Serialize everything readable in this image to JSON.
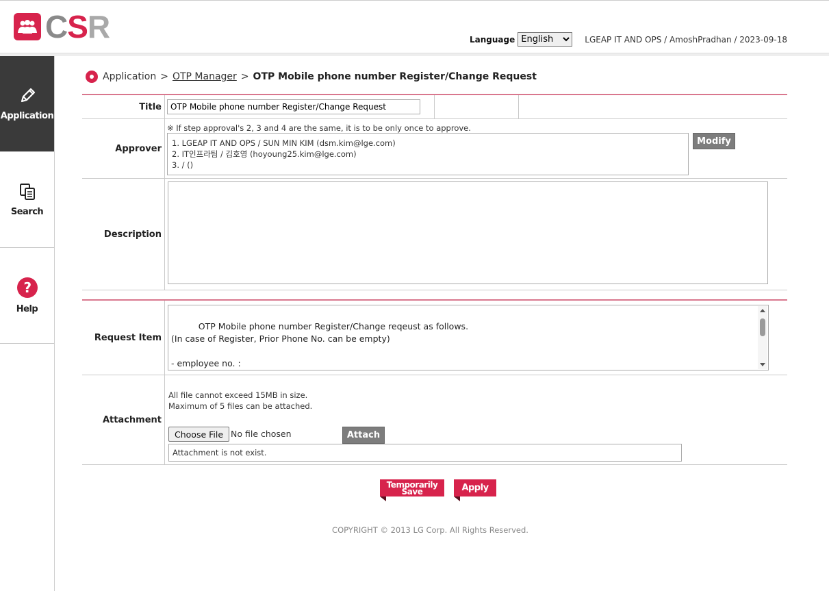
{
  "header": {
    "logo_text": "CSR",
    "language_label": "Language",
    "language_selected": "English",
    "user_info": "LGEAP IT AND OPS / AmoshPradhan / 2023-09-18"
  },
  "sidebar": {
    "items": [
      {
        "label": "Application",
        "icon": "pencil-icon",
        "active": true
      },
      {
        "label": "Search",
        "icon": "documents-icon",
        "active": false
      },
      {
        "label": "Help",
        "icon": "question-icon",
        "active": false
      }
    ]
  },
  "breadcrumb": {
    "root": "Application",
    "sep": ">",
    "link": "OTP Manager",
    "current": "OTP Mobile phone number Register/Change Request"
  },
  "form": {
    "title_label": "Title",
    "title_value": "OTP Mobile phone number Register/Change Request",
    "approver_label": "Approver",
    "approver_note": "※ If step approval's 2, 3 and 4 are the same, it is to be only once to approve.",
    "approvers": [
      "1. LGEAP IT AND OPS / SUN MIN KIM (dsm.kim@lge.com)",
      "2. IT인프라팀 / 김호영 (hoyoung25.kim@lge.com)",
      "3. / ()"
    ],
    "modify_label": "Modify",
    "description_label": "Description",
    "request_label": "Request Item",
    "request_text": "OTP Mobile phone number Register/Change reqeust as follows.\n(In case of Register, Prior Phone No. can be empty)\n\n- employee no. :\n- SSO/EP ID :",
    "attachment_label": "Attachment",
    "attachment_note_1": "All file cannot exceed 15MB in size.",
    "attachment_note_2": "Maximum of 5 files can be attached.",
    "choose_file_label": "Choose File",
    "no_file_text": "No file chosen",
    "attach_label": "Attach",
    "attachment_status": "Attachment is not exist."
  },
  "actions": {
    "temp_save_line1": "Temporarily",
    "temp_save_line2": "Save",
    "apply_label": "Apply"
  },
  "footer": {
    "copyright": "COPYRIGHT © 2013 LG Corp. All Rights Reserved."
  },
  "colors": {
    "brand": "#d7234c",
    "sidebar_active": "#3a3a3a",
    "button_gray": "#7d7d7d"
  }
}
